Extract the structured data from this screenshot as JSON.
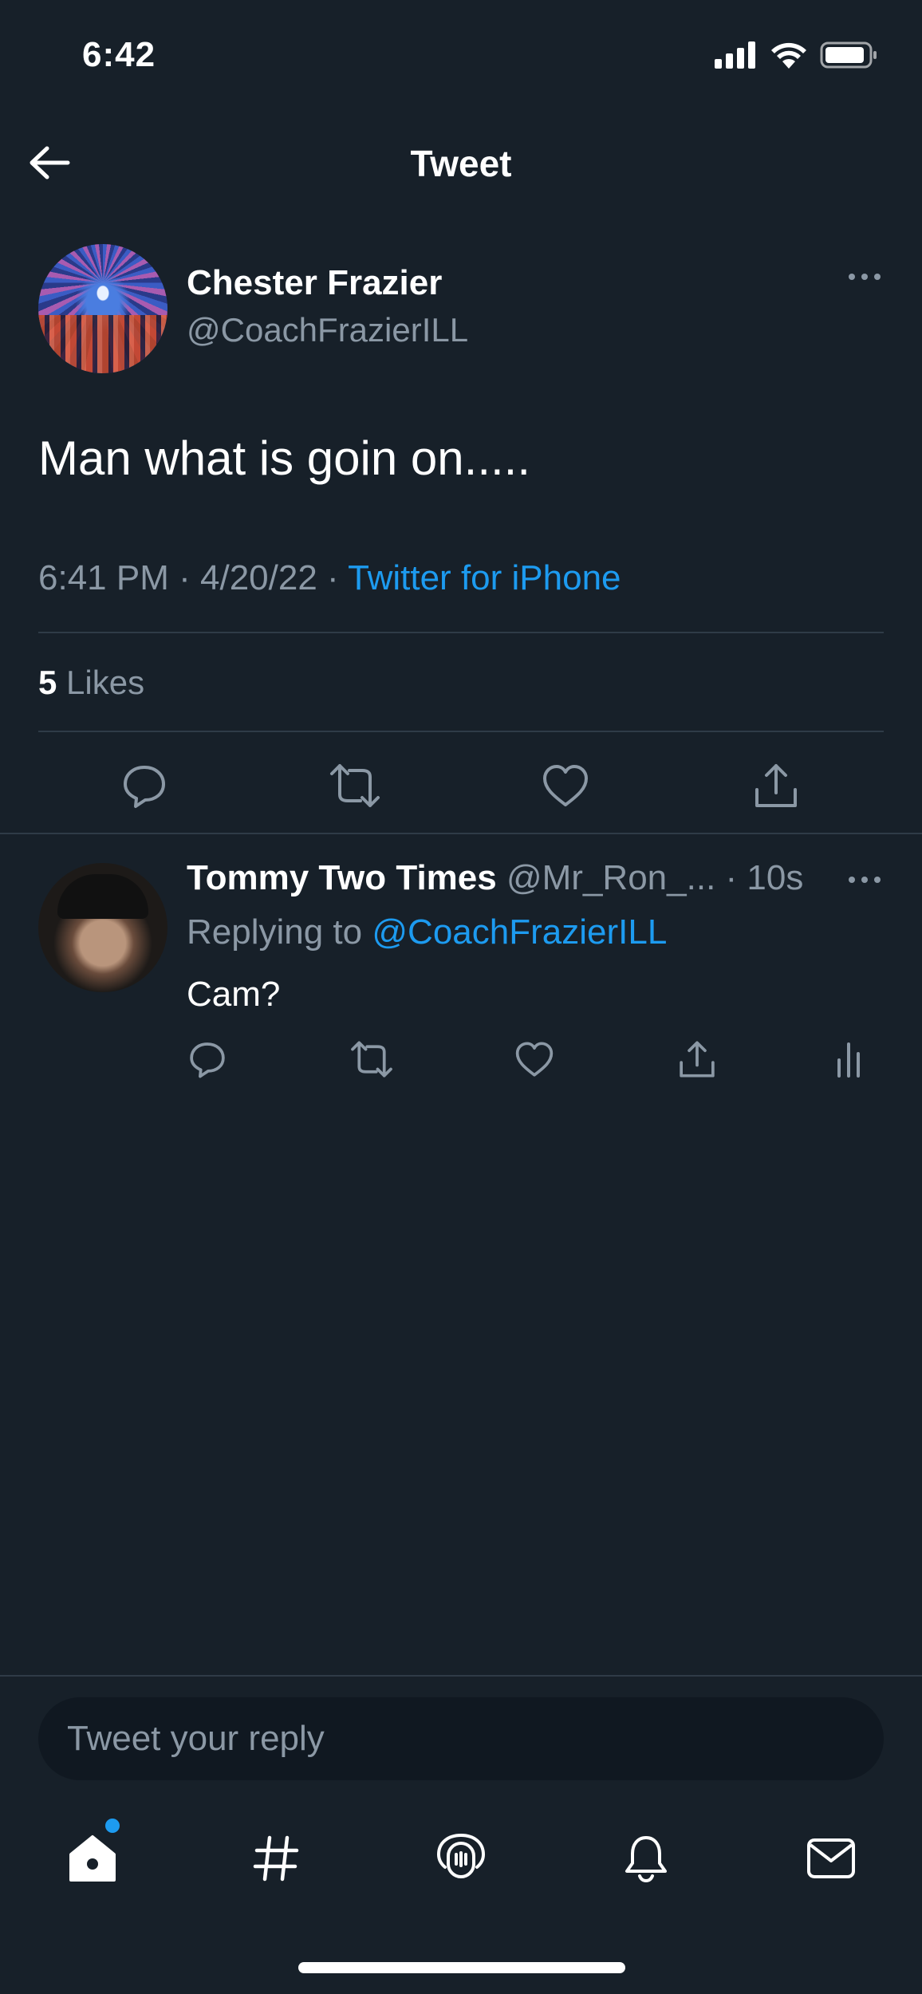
{
  "status_bar": {
    "time": "6:42",
    "icons": [
      "signal-icon",
      "wifi-icon",
      "battery-icon"
    ]
  },
  "header": {
    "title": "Tweet",
    "back_icon": "arrow-left-icon"
  },
  "tweet": {
    "author_name": "Chester Frazier",
    "author_handle": "@CoachFrazierILL",
    "text": "Man what is goin on.....",
    "time": "6:41 PM",
    "date": "4/20/22",
    "separator": "·",
    "source": "Twitter for iPhone",
    "likes_count": "5",
    "likes_label": "Likes",
    "actions": [
      "reply-icon",
      "retweet-icon",
      "like-icon",
      "share-icon"
    ]
  },
  "reply": {
    "author_name": "Tommy Two Times",
    "author_handle": "@Mr_Ron_...",
    "time": "· 10s",
    "replying_prefix": "Replying to",
    "replying_to": "@CoachFrazierILL",
    "text": "Cam?",
    "actions": [
      "reply-icon",
      "retweet-icon",
      "like-icon",
      "share-icon",
      "analytics-icon"
    ]
  },
  "composer": {
    "placeholder": "Tweet your reply"
  },
  "tabbar": {
    "tabs": [
      "home-icon",
      "explore-icon",
      "spaces-icon",
      "notifications-icon",
      "messages-icon"
    ]
  },
  "colors": {
    "background": "#15202b",
    "accent": "#1d9bf0",
    "secondary_text": "#8b98a5",
    "divider": "#2f3b47"
  }
}
